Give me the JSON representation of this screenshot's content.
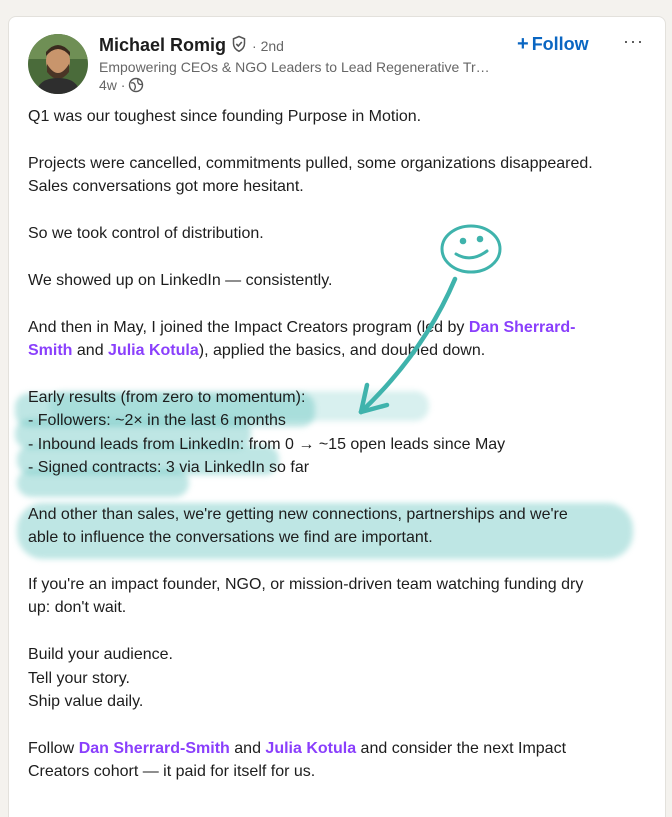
{
  "author": {
    "name": "Michael Romig",
    "degree": "· 2nd",
    "headline": "Empowering CEOs & NGO Leaders to Lead Regenerative Tr…",
    "time": "4w ·"
  },
  "actions": {
    "follow_plus": "+",
    "follow_label": "Follow",
    "more_label": "···"
  },
  "post": {
    "p1": "Q1 was our toughest since founding Purpose in Motion.",
    "p2_l1": "Projects were cancelled, commitments pulled, some organizations disappeared.",
    "p2_l2": "Sales conversations got more hesitant.",
    "p3": "So we took control of distribution.",
    "p4": "We showed up on LinkedIn — consistently.",
    "p5_a": "And then in May, I joined the Impact Creators program (led by ",
    "p5_b": " and ",
    "p5_c": "), applied the basics, and doubled down.",
    "results_title": "Early results (from zero to momentum):",
    "r1_label": "- Followers:",
    "r1_value": " ~2× in the last 6 months",
    "r2_label": "- Inbound leads from LinkedIn:",
    "r2_value": " from 0 → ~15 open leads since May",
    "r3_label": "- Signed contracts:",
    "r3_value": " 3 via LinkedIn so far",
    "p7_l1": "And other than sales, we're getting new connections, partnerships and we're",
    "p7_l2": "able to influence the conversations we find are important.",
    "p8_l1": "If you're an impact founder, NGO, or mission-driven team watching funding dry",
    "p8_l2": "up: don't wait.",
    "p9_l1": "Build your audience.",
    "p9_l2": "Tell your story.",
    "p9_l3": "Ship value daily.",
    "p10_a": "Follow ",
    "p10_b": " and ",
    "p10_c": " and consider the next Impact",
    "p10_l2": "Creators cohort — it paid for itself for us."
  },
  "mentions": {
    "dan_l1": "Dan Sherrard-",
    "dan_l2": "Smith",
    "dan_full": "Dan Sherrard-Smith",
    "julia": "Julia Kotula"
  },
  "colors": {
    "follow": "#0a66c2",
    "mention": "#8a3ffc",
    "highlight": "#6ec8c3",
    "annotation": "#3fb3ac"
  },
  "icons": [
    "verified-icon",
    "globe-icon",
    "smiley-doodle-icon",
    "arrow-doodle-icon"
  ]
}
